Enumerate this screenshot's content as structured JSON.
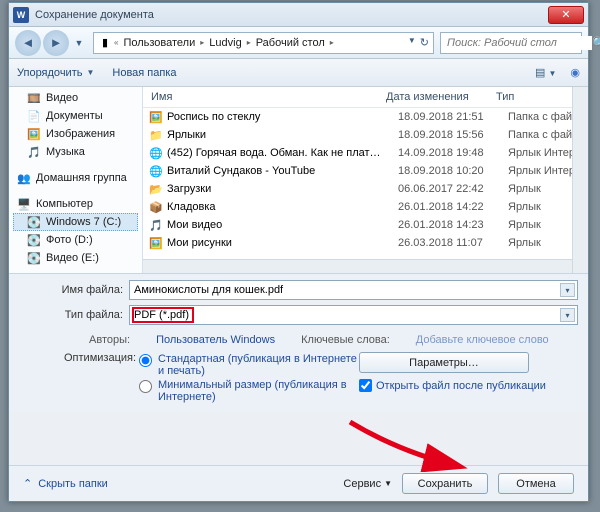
{
  "title": "Сохранение документа",
  "breadcrumb": [
    "Пользователи",
    "Ludvig",
    "Рабочий стол"
  ],
  "search_placeholder": "Поиск: Рабочий стол",
  "toolbar": {
    "organize": "Упорядочить",
    "newfolder": "Новая папка"
  },
  "tree": {
    "video": "Видео",
    "documents": "Документы",
    "images": "Изображения",
    "music": "Музыка",
    "homegroup": "Домашняя группа",
    "computer": "Компьютер",
    "drive_c": "Windows 7 (C:)",
    "drive_photo": "Фото (D:)",
    "drive_video": "Видео (E:)"
  },
  "columns": {
    "name": "Имя",
    "date": "Дата изменения",
    "type": "Тип"
  },
  "rows": [
    {
      "ico": "🖼️",
      "name": "Роспись по стеклу",
      "date": "18.09.2018 21:51",
      "type": "Папка с файлам"
    },
    {
      "ico": "📁",
      "name": "Ярлыки",
      "date": "18.09.2018 15:56",
      "type": "Папка с файлам"
    },
    {
      "ico": "🌐",
      "name": "(452) Горячая вода. Обман. Как не плат…",
      "date": "14.09.2018 19:48",
      "type": "Ярлык Интернет"
    },
    {
      "ico": "🌐",
      "name": "Виталий Сундаков - YouTube",
      "date": "18.09.2018 10:20",
      "type": "Ярлык Интернет"
    },
    {
      "ico": "📂",
      "name": "Загрузки",
      "date": "06.06.2017 22:42",
      "type": "Ярлык"
    },
    {
      "ico": "📦",
      "name": "Кладовка",
      "date": "26.01.2018 14:22",
      "type": "Ярлык"
    },
    {
      "ico": "🎵",
      "name": "Мои видео",
      "date": "26.01.2018 14:23",
      "type": "Ярлык"
    },
    {
      "ico": "🖼️",
      "name": "Мои рисунки",
      "date": "26.03.2018 11:07",
      "type": "Ярлык"
    }
  ],
  "filename_label": "Имя файла:",
  "filename_value": "Аминокислоты для кошек.pdf",
  "filetype_label": "Тип файла:",
  "filetype_value": "PDF (*.pdf)",
  "authors_label": "Авторы:",
  "authors_value": "Пользователь Windows",
  "keywords_label": "Ключевые слова:",
  "keywords_value": "Добавьте ключевое слово",
  "optimize_label": "Оптимизация:",
  "opt_standard": "Стандартная (публикация в Интернете и печать)",
  "opt_min": "Минимальный размер (публикация в Интернете)",
  "params_btn": "Параметры…",
  "openafter": "Открыть файл после публикации",
  "hide_folders": "Скрыть папки",
  "service": "Сервис",
  "save": "Сохранить",
  "cancel": "Отмена"
}
